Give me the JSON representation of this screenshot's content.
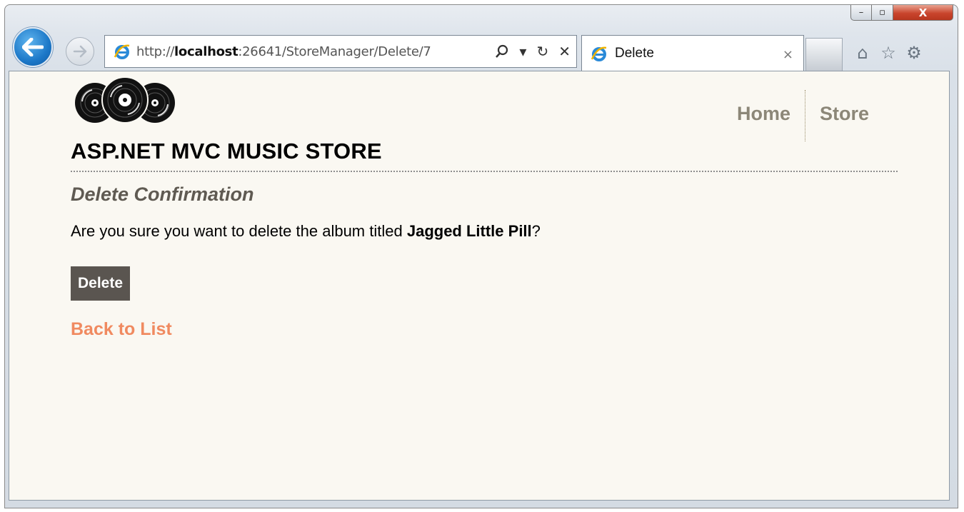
{
  "browser": {
    "url_prefix": "http://",
    "url_host": "localhost",
    "url_rest": ":26641/StoreManager/Delete/7",
    "tab_title": "Delete",
    "search_icon": "search-icon",
    "dropdown_glyph": "▾",
    "refresh_glyph": "↻",
    "stop_glyph": "✕",
    "tab_close_glyph": "×",
    "minimize_glyph": "–",
    "maximize_glyph": "▫",
    "close_glyph": "X",
    "home_glyph": "⌂",
    "favorites_glyph": "☆",
    "tools_glyph": "⚙"
  },
  "site": {
    "title": "ASP.NET MVC MUSIC STORE",
    "nav": {
      "home": "Home",
      "store": "Store"
    }
  },
  "page": {
    "heading": "Delete Confirmation",
    "prompt_before": "Are you sure you want to delete the album titled ",
    "album_title": "Jagged Little Pill",
    "prompt_after": "?",
    "delete_button": "Delete",
    "back_link": "Back to List"
  },
  "colors": {
    "page_background": "#faf8f2",
    "nav_link": "#8c8778",
    "heading": "#5f5a52",
    "button_bg": "#5a5550",
    "back_link": "#f08a60"
  }
}
